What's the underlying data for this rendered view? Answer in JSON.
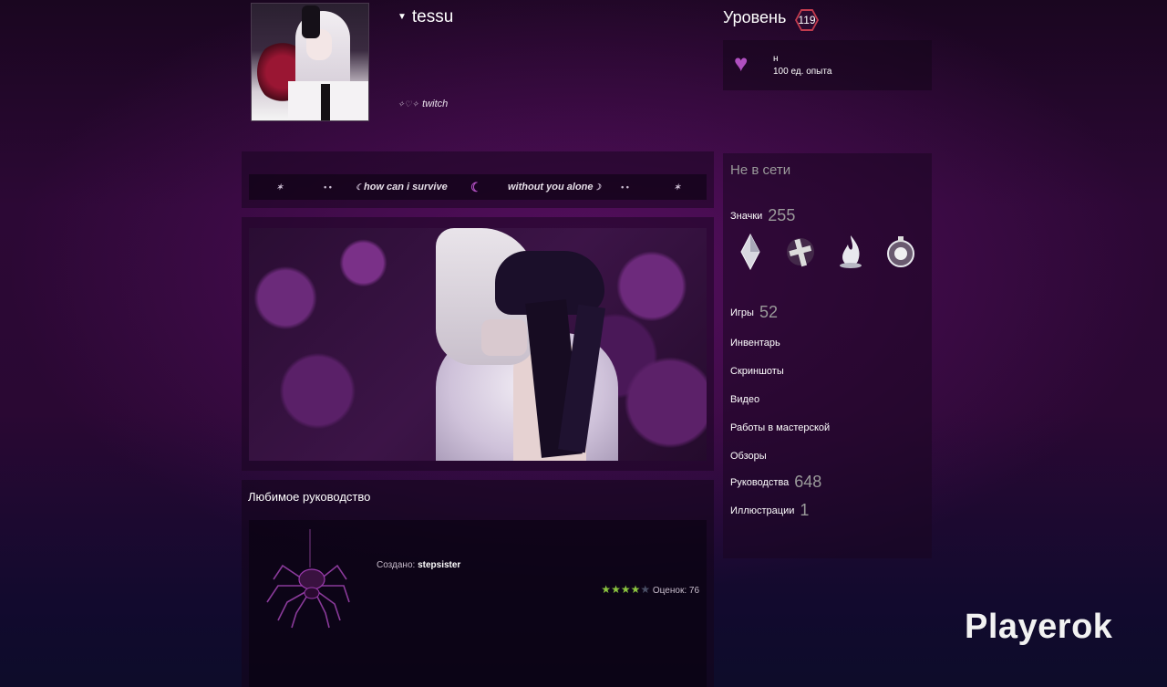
{
  "header": {
    "persona_name": "tessu",
    "profile_link_text": "twitch",
    "level_label": "Уровень",
    "level_value": "119"
  },
  "featured_badge": {
    "name": "н",
    "xp": "100 ед. опыта",
    "icon": "heart-icon"
  },
  "quote_showcase": {
    "text_left": "how can i survive",
    "text_right": "without you alone"
  },
  "favorite_guide": {
    "title": "Любимое руководство",
    "author_label": "Создано:",
    "author": "stepsister",
    "stars_filled": 4,
    "stars_total": 5,
    "ratings_label": "Оценок: 76"
  },
  "right_column": {
    "status": "Не в сети",
    "badges_label": "Значки",
    "badges_count": "255",
    "badge_icons": [
      "crystal-badge-icon",
      "cross-badge-icon",
      "flame-badge-icon",
      "orb-badge-icon"
    ],
    "games_label": "Игры",
    "games_count": "52",
    "inventory_label": "Инвентарь",
    "screenshots_label": "Скриншоты",
    "videos_label": "Видео",
    "workshop_label": "Работы в мастерской",
    "reviews_label": "Обзоры",
    "guides_label": "Руководства",
    "guides_count": "648",
    "artwork_label": "Иллюстрации",
    "artwork_count": "1"
  },
  "watermark": "Playerok",
  "colors": {
    "accent_purple": "#b04fc0",
    "star_green": "#8bc53f",
    "level_ring": "#c23b4e"
  }
}
